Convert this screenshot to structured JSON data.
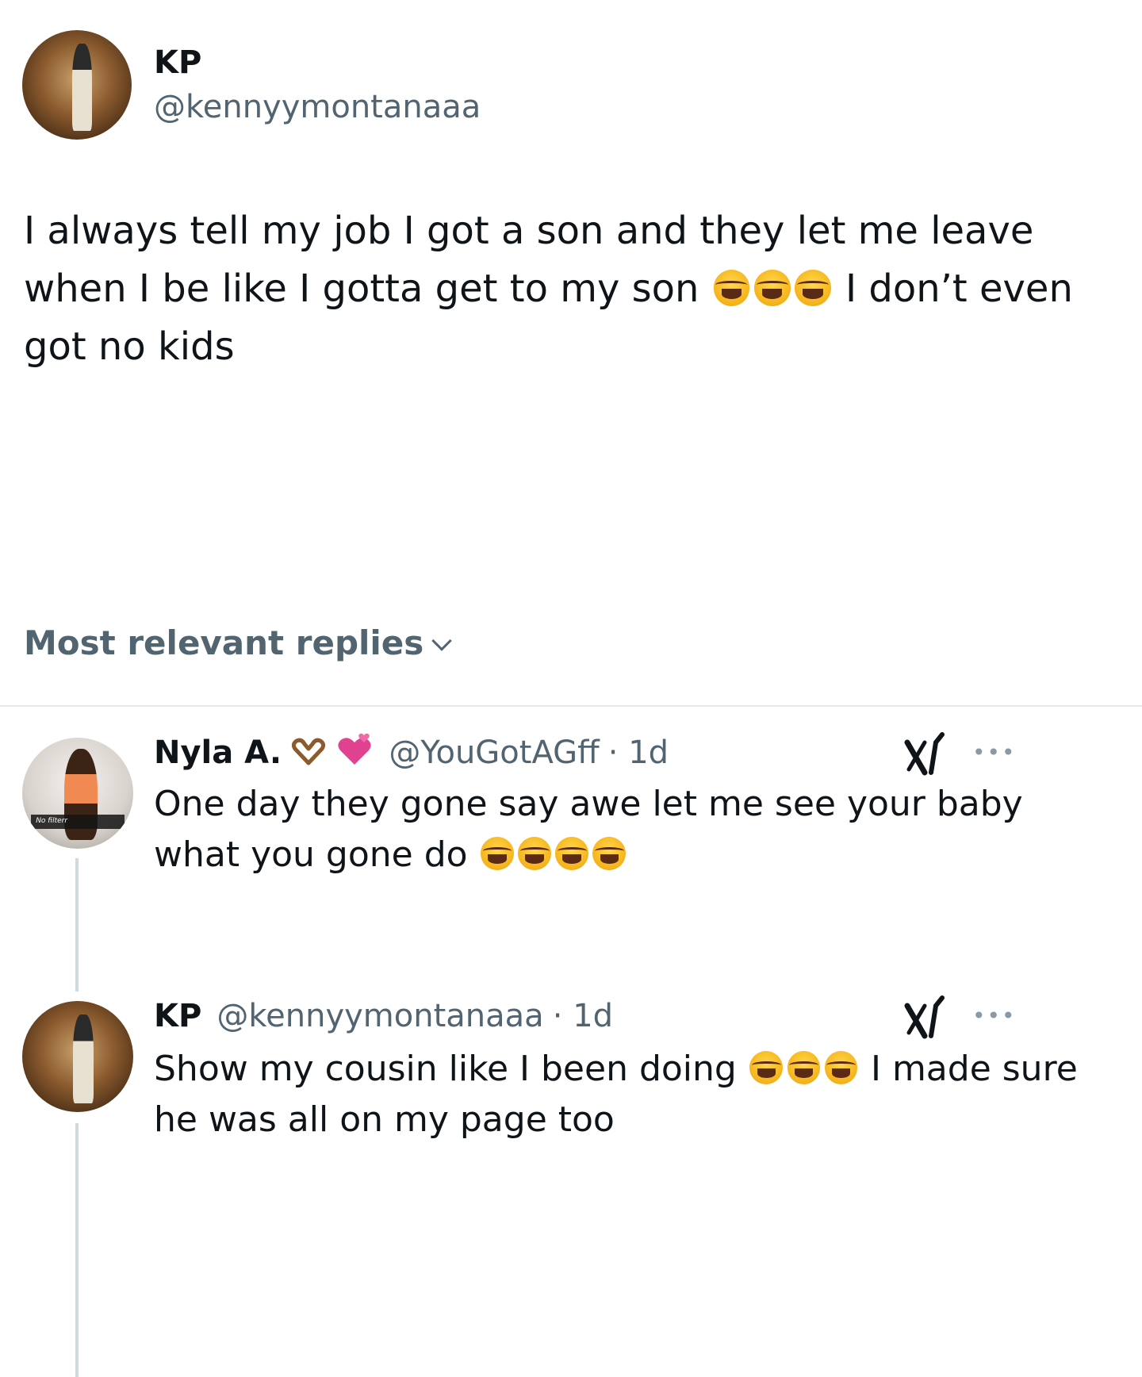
{
  "tweet": {
    "author_name": "KP",
    "author_handle": "@kennyymontanaaa",
    "text_part1": "I always tell my job I got a son and they let me leave when I be like I gotta get to my son",
    "text_part2": "I don’t even got no kids"
  },
  "replies_sort": {
    "label": "Most relevant replies"
  },
  "replies": [
    {
      "author_name": "Nyla A.",
      "author_handle": "@YouGotAGff",
      "time": "· 1d",
      "text": "One day they gone say awe let me see your baby what you gone do",
      "avatar_caption": "No filterr"
    },
    {
      "author_name": "KP",
      "author_handle": "@kennyymontanaaa",
      "time": "· 1d",
      "text_part1": "Show my cousin like I been doing",
      "text_part2": "I made sure he was all on my page too"
    }
  ],
  "icons": {
    "avatar": "profile-photo",
    "emoji": "face-with-tears-of-joy",
    "heart_hands": "heart-hands-emoji",
    "heart": "revolving-hearts-emoji",
    "x_logo": "grok-x-icon",
    "more": "more-icon"
  },
  "colors": {
    "text_primary": "#0f1419",
    "text_secondary": "#536471",
    "divider": "#e6e9ec",
    "emoji_yellow": "#f5b21b"
  }
}
